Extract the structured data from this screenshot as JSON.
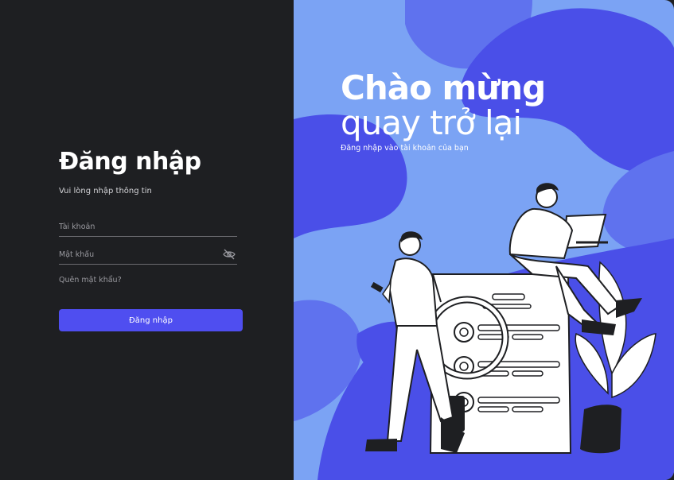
{
  "login": {
    "title": "Đăng nhập",
    "subtitle": "Vui lòng nhập thông tin",
    "username_placeholder": "Tài khoản",
    "password_placeholder": "Mật khẩu",
    "forgot_label": "Quên mật khẩu?",
    "submit_label": "Đăng nhập"
  },
  "welcome": {
    "line1": "Chào mừng",
    "line2": "quay trở lại",
    "subtitle": "Đăng nhập vào tài khoản của bạn"
  },
  "icons": {
    "password_toggle": "eye-off-icon"
  },
  "colors": {
    "left_background": "#1e1f22",
    "accent": "#4f4ef0",
    "right_background": "#7ba3f4",
    "blob_dark": "#4a4fe8",
    "blob_mid": "#5f72ee"
  }
}
